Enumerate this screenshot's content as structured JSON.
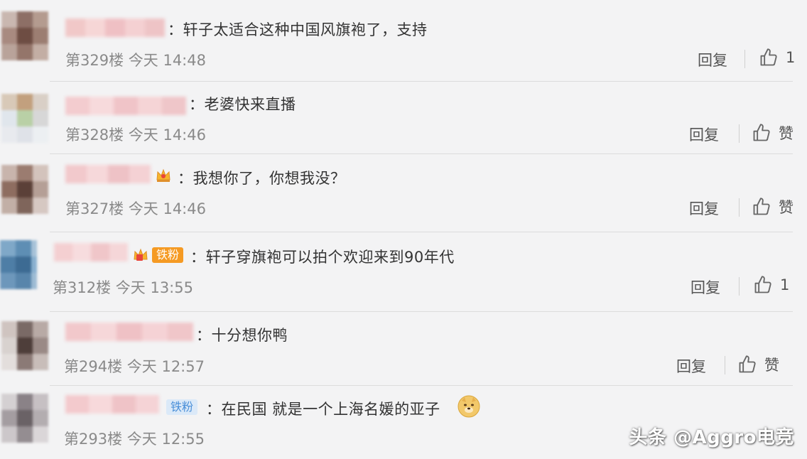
{
  "comments": [
    {
      "text": "轩子太适合这种中国风旗袍了，支持",
      "floor": "第329楼",
      "time": "今天 14:48",
      "reply": "回复",
      "like": "1"
    },
    {
      "text": "老婆快来直播",
      "floor": "第328楼",
      "time": "今天 14:46",
      "reply": "回复",
      "like": "赞"
    },
    {
      "text": "我想你了，你想我没？",
      "floor": "第327楼",
      "time": "今天 14:46",
      "reply": "回复",
      "like": "赞"
    },
    {
      "text": "轩子穿旗袍可以拍个欢迎来到90年代",
      "floor": "第312楼",
      "time": "今天 13:55",
      "reply": "回复",
      "like": "1",
      "badge": "铁粉"
    },
    {
      "text": "十分想你鸭",
      "floor": "第294楼",
      "time": "今天 12:57",
      "reply": "回复",
      "like": "赞"
    },
    {
      "text": "在民国 就是一个上海名媛的亚子",
      "floor": "第293楼",
      "time": "今天 12:55",
      "badge": "铁粉"
    }
  ],
  "colon": "：",
  "watermark": "头条 @Aggro电竞",
  "colors": {
    "background": "#f3f3f4",
    "text": "#333333",
    "meta": "#8a8a8a",
    "fan_badge_orange": "#f59a23",
    "fan_badge_blue": "#6fa8e6"
  },
  "icons": [
    "crown-icon",
    "thumbs-up-icon",
    "doge-emoji-icon"
  ]
}
